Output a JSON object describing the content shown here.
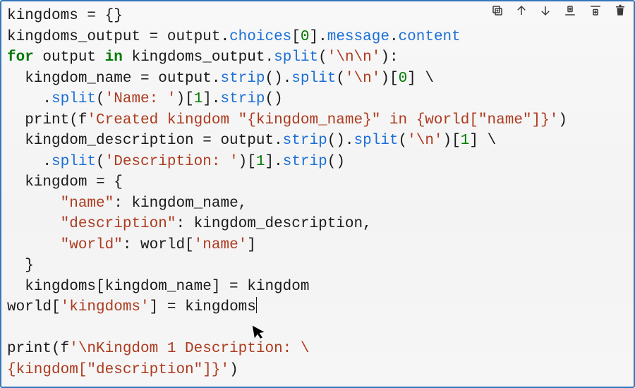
{
  "toolbar": {
    "duplicate": "duplicate-icon",
    "up": "arrow-up-icon",
    "down": "arrow-down-icon",
    "insert_above": "insert-above-icon",
    "insert_below": "insert-below-icon",
    "delete": "trash-icon"
  },
  "code": {
    "l1_a": "kingdoms = {}",
    "l2_a": "kingdoms_output = output",
    "l2_b": "choices",
    "l2_c": "0",
    "l2_d": "message",
    "l2_e": "content",
    "l3_a": "for",
    "l3_b": " output ",
    "l3_c": "in",
    "l3_d": " kingdoms_output",
    "l3_e": "split",
    "l3_f": "'\\n\\n'",
    "l4_a": "  kingdom_name = output",
    "l4_b": "strip",
    "l4_c": "split",
    "l4_d": "'\\n'",
    "l4_e": "0",
    "l5_a": "    .",
    "l5_b": "split",
    "l5_c": "'Name: '",
    "l5_d": "1",
    "l5_e": "strip",
    "l6_a": "  print(f",
    "l6_b": "'Created kingdom \"{kingdom_name}\" in {world[\"name\"]}'",
    "l7_a": "  kingdom_description = output",
    "l7_b": "strip",
    "l7_c": "split",
    "l7_d": "'\\n'",
    "l7_e": "1",
    "l8_a": "    .",
    "l8_b": "split",
    "l8_c": "'Description: '",
    "l8_d": "1",
    "l8_e": "strip",
    "l9_a": "  kingdom = {",
    "l10_a": "      ",
    "l10_b": "\"name\"",
    "l10_c": ": kingdom_name,",
    "l11_a": "      ",
    "l11_b": "\"description\"",
    "l11_c": ": kingdom_description,",
    "l12_a": "      ",
    "l12_b": "\"world\"",
    "l12_c": ": world[",
    "l12_d": "'name'",
    "l12_e": "]",
    "l13_a": "  }",
    "l14_a": "  kingdoms[kingdom_name] = kingdom",
    "l15_a": "world[",
    "l15_b": "'kingdoms'",
    "l15_c": "] = kingdoms",
    "l17_a": "print(f",
    "l17_b": "'\\nKingdom 1 Description: \\",
    "l18_a": "{kingdom[\"description\"]}'",
    "l18_b": ")"
  }
}
